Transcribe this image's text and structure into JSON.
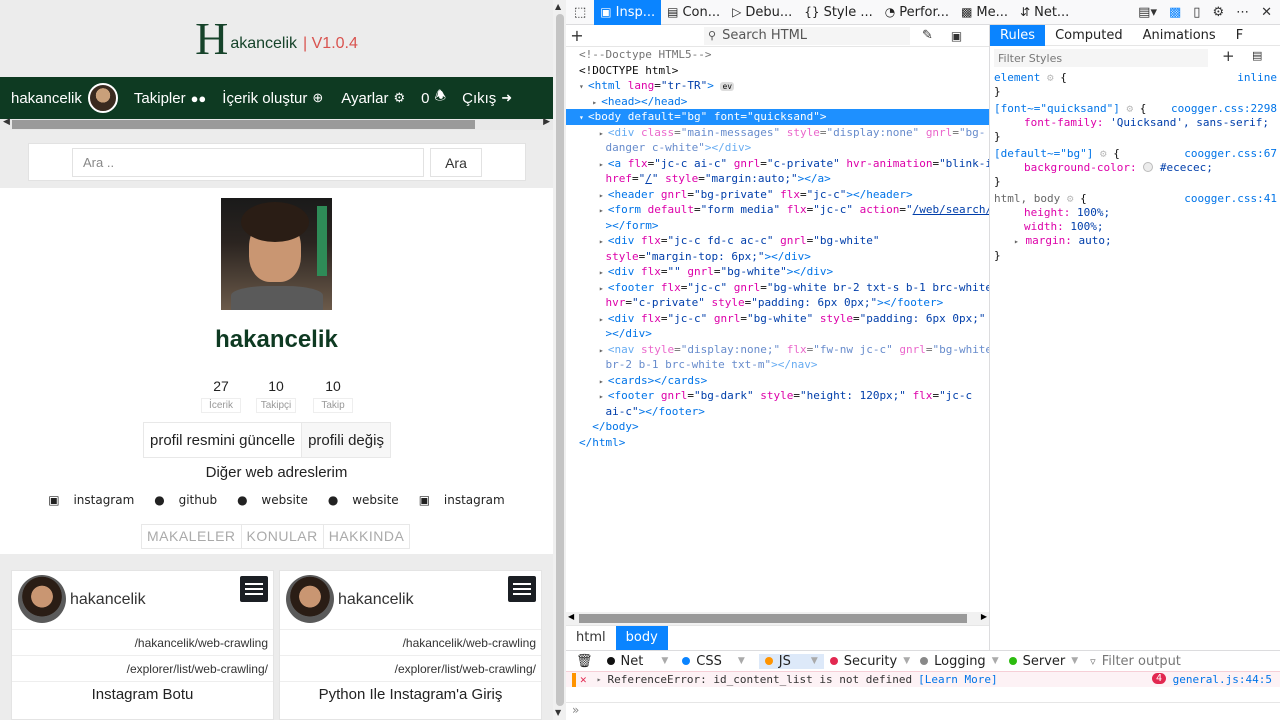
{
  "site": {
    "logo_letter": "H",
    "logo_name": "akancelik",
    "logo_version": "| V1.0.4",
    "nav": {
      "user": "hakancelik",
      "followers": "Takipler",
      "create": "İçerik oluştur",
      "settings": "Ayarlar",
      "notif_count": "0",
      "logout": "Çıkış"
    },
    "search": {
      "placeholder": "Ara ..",
      "button": "Ara"
    },
    "profile": {
      "username": "hakancelik",
      "stats": [
        {
          "num": "27",
          "label": "İcerik"
        },
        {
          "num": "10",
          "label": "Takipçi"
        },
        {
          "num": "10",
          "label": "Takip"
        }
      ],
      "update_photo": "profil resmini güncelle",
      "change_profile": "profili değiş",
      "other_web": "Diğer web adreslerim",
      "links": [
        "instagram",
        "github",
        "website",
        "website",
        "instagram"
      ],
      "tabs": [
        "MAKALELER",
        "KONULAR",
        "HAKKINDA"
      ]
    },
    "cards": [
      {
        "author": "hakancelik",
        "path1": "/hakancelik/web-crawling",
        "path2": "/explorer/list/web-crawling/",
        "title": "Instagram Botu"
      },
      {
        "author": "hakancelik",
        "path1": "/hakancelik/web-crawling",
        "path2": "/explorer/list/web-crawling/",
        "title": "Python Ile Instagram'a Giriş"
      }
    ]
  },
  "devtools": {
    "tabs": [
      "Insp...",
      "Con...",
      "Debu...",
      "Style ...",
      "Perfor...",
      "Me...",
      "Net..."
    ],
    "search_html": "Search HTML",
    "rules_tabs": [
      "Rules",
      "Computed",
      "Animations",
      "F"
    ],
    "filter_styles": "Filter Styles",
    "breadcrumbs": [
      "html",
      "body"
    ],
    "console_filters": [
      "Net",
      "CSS",
      "JS",
      "Security",
      "Logging",
      "Server"
    ],
    "filter_output": "Filter output",
    "error_text": "ReferenceError: id_content_list is not defined",
    "error_link": "[Learn More]",
    "error_count": "4",
    "error_source": "general.js:44:5",
    "rules": [
      {
        "selector": "element",
        "source": "inline",
        "props": []
      },
      {
        "selector": "[font~=\"quicksand\"]",
        "source": "coogger.css:2298",
        "props": [
          {
            "name": "font-family",
            "value": "'Quicksand', sans-serif;"
          }
        ]
      },
      {
        "selector": "[default~=\"bg\"]",
        "source": "coogger.css:67",
        "props": [
          {
            "name": "background-color",
            "value": "#ececec;"
          }
        ]
      },
      {
        "selector": "html, body",
        "source": "coogger.css:41",
        "props": [
          {
            "name": "height",
            "value": "100%;"
          },
          {
            "name": "width",
            "value": "100%;"
          },
          {
            "name": "margin",
            "value": "auto;"
          }
        ]
      }
    ]
  }
}
